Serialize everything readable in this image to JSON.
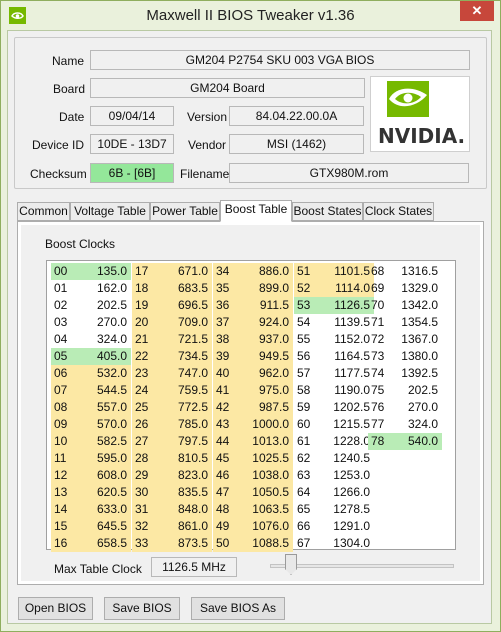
{
  "window": {
    "title": "Maxwell II BIOS Tweaker v1.36",
    "close_glyph": "✕"
  },
  "info": {
    "name_label": "Name",
    "name_value": "GM204 P2754 SKU 003 VGA BIOS",
    "board_label": "Board",
    "board_value": "GM204 Board",
    "date_label": "Date",
    "date_value": "09/04/14",
    "version_label": "Version",
    "version_value": "84.04.22.00.0A",
    "device_label": "Device ID",
    "device_value": "10DE - 13D7",
    "vendor_label": "Vendor",
    "vendor_value": "MSI (1462)",
    "checksum_label": "Checksum",
    "checksum_value": "6B - [6B]",
    "checksum_color": "#94e79a",
    "filename_label": "Filename",
    "filename_value": "GTX980M.rom",
    "logo_text": "NVIDIA.",
    "logo_color": "#76b900"
  },
  "tabs": [
    {
      "label": "Common"
    },
    {
      "label": "Voltage Table"
    },
    {
      "label": "Power Table"
    },
    {
      "label": "Boost Table"
    },
    {
      "label": "Boost States"
    },
    {
      "label": "Clock States"
    }
  ],
  "active_tab": "Boost Table",
  "boost": {
    "group_label": "Boost Clocks",
    "colors": {
      "yellow": "#fce8a4",
      "green": "#b9ecb6"
    },
    "columns": [
      [
        {
          "i": "00",
          "v": "135.0",
          "c": "g"
        },
        {
          "i": "01",
          "v": "162.0",
          "c": ""
        },
        {
          "i": "02",
          "v": "202.5",
          "c": ""
        },
        {
          "i": "03",
          "v": "270.0",
          "c": ""
        },
        {
          "i": "04",
          "v": "324.0",
          "c": ""
        },
        {
          "i": "05",
          "v": "405.0",
          "c": "g"
        },
        {
          "i": "06",
          "v": "532.0",
          "c": "y"
        },
        {
          "i": "07",
          "v": "544.5",
          "c": "y"
        },
        {
          "i": "08",
          "v": "557.0",
          "c": "y"
        },
        {
          "i": "09",
          "v": "570.0",
          "c": "y"
        },
        {
          "i": "10",
          "v": "582.5",
          "c": "y"
        },
        {
          "i": "11",
          "v": "595.0",
          "c": "y"
        },
        {
          "i": "12",
          "v": "608.0",
          "c": "y"
        },
        {
          "i": "13",
          "v": "620.5",
          "c": "y"
        },
        {
          "i": "14",
          "v": "633.0",
          "c": "y"
        },
        {
          "i": "15",
          "v": "645.5",
          "c": "y"
        },
        {
          "i": "16",
          "v": "658.5",
          "c": "y"
        }
      ],
      [
        {
          "i": "17",
          "v": "671.0",
          "c": "y"
        },
        {
          "i": "18",
          "v": "683.5",
          "c": "y"
        },
        {
          "i": "19",
          "v": "696.5",
          "c": "y"
        },
        {
          "i": "20",
          "v": "709.0",
          "c": "y"
        },
        {
          "i": "21",
          "v": "721.5",
          "c": "y"
        },
        {
          "i": "22",
          "v": "734.5",
          "c": "y"
        },
        {
          "i": "23",
          "v": "747.0",
          "c": "y"
        },
        {
          "i": "24",
          "v": "759.5",
          "c": "y"
        },
        {
          "i": "25",
          "v": "772.5",
          "c": "y"
        },
        {
          "i": "26",
          "v": "785.0",
          "c": "y"
        },
        {
          "i": "27",
          "v": "797.5",
          "c": "y"
        },
        {
          "i": "28",
          "v": "810.5",
          "c": "y"
        },
        {
          "i": "29",
          "v": "823.0",
          "c": "y"
        },
        {
          "i": "30",
          "v": "835.5",
          "c": "y"
        },
        {
          "i": "31",
          "v": "848.0",
          "c": "y"
        },
        {
          "i": "32",
          "v": "861.0",
          "c": "y"
        },
        {
          "i": "33",
          "v": "873.5",
          "c": "y"
        }
      ],
      [
        {
          "i": "34",
          "v": "886.0",
          "c": "y"
        },
        {
          "i": "35",
          "v": "899.0",
          "c": "y"
        },
        {
          "i": "36",
          "v": "911.5",
          "c": "y"
        },
        {
          "i": "37",
          "v": "924.0",
          "c": "y"
        },
        {
          "i": "38",
          "v": "937.0",
          "c": "y"
        },
        {
          "i": "39",
          "v": "949.5",
          "c": "y"
        },
        {
          "i": "40",
          "v": "962.0",
          "c": "y"
        },
        {
          "i": "41",
          "v": "975.0",
          "c": "y"
        },
        {
          "i": "42",
          "v": "987.5",
          "c": "y"
        },
        {
          "i": "43",
          "v": "1000.0",
          "c": "y"
        },
        {
          "i": "44",
          "v": "1013.0",
          "c": "y"
        },
        {
          "i": "45",
          "v": "1025.5",
          "c": "y"
        },
        {
          "i": "46",
          "v": "1038.0",
          "c": "y"
        },
        {
          "i": "47",
          "v": "1050.5",
          "c": "y"
        },
        {
          "i": "48",
          "v": "1063.5",
          "c": "y"
        },
        {
          "i": "49",
          "v": "1076.0",
          "c": "y"
        },
        {
          "i": "50",
          "v": "1088.5",
          "c": "y"
        }
      ],
      [
        {
          "i": "51",
          "v": "1101.5",
          "c": "y"
        },
        {
          "i": "52",
          "v": "1114.0",
          "c": "y"
        },
        {
          "i": "53",
          "v": "1126.5",
          "c": "g"
        },
        {
          "i": "54",
          "v": "1139.5",
          "c": ""
        },
        {
          "i": "55",
          "v": "1152.0",
          "c": ""
        },
        {
          "i": "56",
          "v": "1164.5",
          "c": ""
        },
        {
          "i": "57",
          "v": "1177.5",
          "c": ""
        },
        {
          "i": "58",
          "v": "1190.0",
          "c": ""
        },
        {
          "i": "59",
          "v": "1202.5",
          "c": ""
        },
        {
          "i": "60",
          "v": "1215.5",
          "c": ""
        },
        {
          "i": "61",
          "v": "1228.0",
          "c": ""
        },
        {
          "i": "62",
          "v": "1240.5",
          "c": ""
        },
        {
          "i": "63",
          "v": "1253.0",
          "c": ""
        },
        {
          "i": "64",
          "v": "1266.0",
          "c": ""
        },
        {
          "i": "65",
          "v": "1278.5",
          "c": ""
        },
        {
          "i": "66",
          "v": "1291.0",
          "c": ""
        },
        {
          "i": "67",
          "v": "1304.0",
          "c": ""
        }
      ],
      [
        {
          "i": "68",
          "v": "1316.5",
          "c": ""
        },
        {
          "i": "69",
          "v": "1329.0",
          "c": ""
        },
        {
          "i": "70",
          "v": "1342.0",
          "c": ""
        },
        {
          "i": "71",
          "v": "1354.5",
          "c": ""
        },
        {
          "i": "72",
          "v": "1367.0",
          "c": ""
        },
        {
          "i": "73",
          "v": "1380.0",
          "c": ""
        },
        {
          "i": "74",
          "v": "1392.5",
          "c": ""
        },
        {
          "i": "75",
          "v": "202.5",
          "c": ""
        },
        {
          "i": "76",
          "v": "270.0",
          "c": ""
        },
        {
          "i": "77",
          "v": "324.0",
          "c": ""
        },
        {
          "i": "78",
          "v": "540.0",
          "c": "g"
        }
      ]
    ],
    "max_clock_label": "Max Table Clock",
    "max_clock_value": "1126.5 MHz"
  },
  "buttons": {
    "open": "Open BIOS",
    "save": "Save BIOS",
    "save_as": "Save BIOS As"
  }
}
